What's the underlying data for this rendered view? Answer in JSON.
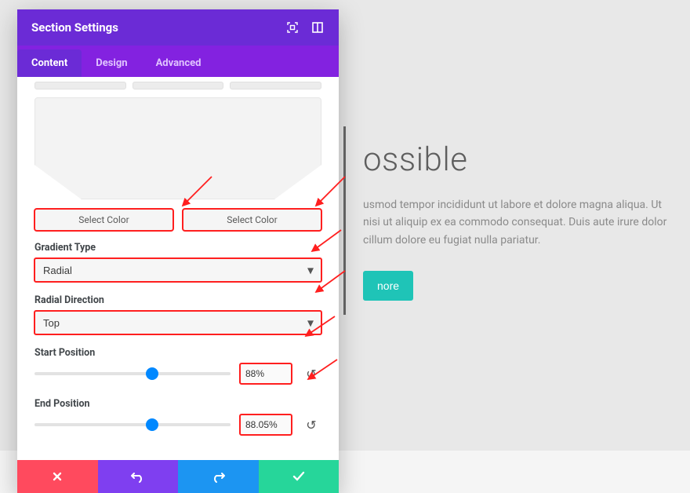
{
  "page": {
    "heading_visible": "ossible",
    "para_visible": "usmod tempor incididunt ut labore et dolore magna aliqua. Ut nisi ut aliquip ex ea commodo consequat. Duis aute irure dolor cillum dolore eu fugiat nulla pariatur.",
    "learn_more_visible": "nore"
  },
  "panel": {
    "title": "Section Settings",
    "tabs": {
      "content": "Content",
      "design": "Design",
      "advanced": "Advanced"
    },
    "color_picker_label": "Select Color",
    "gradient_type": {
      "label": "Gradient Type",
      "value": "Radial"
    },
    "radial_direction": {
      "label": "Radial Direction",
      "value": "Top"
    },
    "start_position": {
      "label": "Start Position",
      "value": "88%"
    },
    "end_position": {
      "label": "End Position",
      "value": "88.05%"
    }
  }
}
